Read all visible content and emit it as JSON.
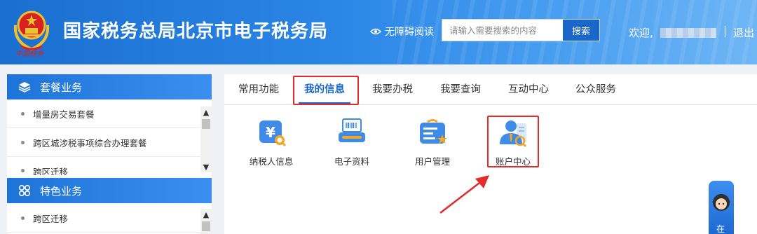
{
  "header": {
    "emblem_text": "中国税务",
    "title": "国家税务总局北京市电子税务局",
    "accessibility_label": "无障碍阅读",
    "search_placeholder": "请输入需要搜索的内容",
    "search_button": "搜索",
    "welcome_text": "欢迎,",
    "logout_label": "退出"
  },
  "sidebar": {
    "sections": [
      {
        "title": "套餐业务",
        "icon": "layers-icon",
        "items": [
          "增量房交易套餐",
          "跨区城涉税事项综合办理套餐",
          "跨区迁移"
        ]
      },
      {
        "title": "特色业务",
        "icon": "grid-icon",
        "items": [
          "跨区迁移"
        ]
      }
    ]
  },
  "main": {
    "tabs": [
      "常用功能",
      "我的信息",
      "我要办税",
      "我要查询",
      "互动中心",
      "公众服务"
    ],
    "active_tab": "我的信息",
    "functions": [
      {
        "label": "纳税人信息",
        "icon": "taxpayer-info-icon"
      },
      {
        "label": "电子资料",
        "icon": "electronic-records-icon"
      },
      {
        "label": "用户管理",
        "icon": "user-management-icon"
      },
      {
        "label": "账户中心",
        "icon": "account-center-icon"
      }
    ]
  },
  "float_widget": {
    "label": "在"
  },
  "colors": {
    "primary": "#1b66c9",
    "header_blue": "#2b86e6",
    "highlight_red": "#e32b2b",
    "icon_orange": "#f5a623"
  }
}
